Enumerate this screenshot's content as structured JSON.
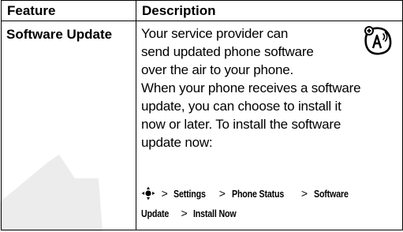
{
  "table": {
    "headers": [
      "Feature",
      "Description"
    ],
    "row": {
      "feature": "Software Update",
      "description_lines": [
        "Your service provider can",
        "send updated phone software",
        "over the air to your phone.",
        "When your phone receives a software",
        "update, you can choose to install it",
        "now or later. To install the software",
        "update now:"
      ],
      "icon": "ota-network-feature-icon",
      "path": {
        "key_icon": "navigation-key-icon",
        "separator": ">",
        "items": [
          "Settings",
          "Phone Status",
          "Software",
          "Update",
          "Install Now"
        ]
      }
    }
  }
}
